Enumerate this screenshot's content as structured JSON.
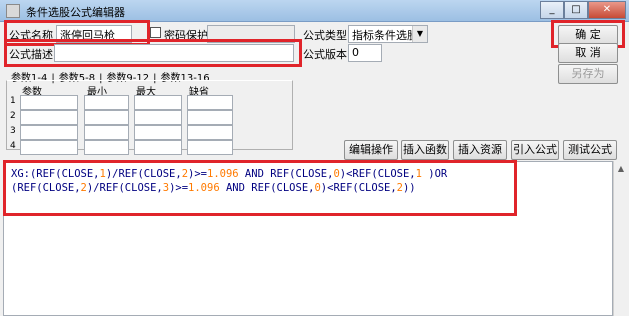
{
  "window": {
    "title": "条件选股公式编辑器",
    "min_label": "_",
    "max_label": "□",
    "close_label": "✕"
  },
  "form": {
    "name_label": "公式名称",
    "name_value": "涨停回马枪",
    "password_label": "密码保护",
    "password_value": "",
    "type_label": "公式类型",
    "type_value": "指标条件选股",
    "desc_label": "公式描述",
    "desc_value": "",
    "version_label": "公式版本",
    "version_value": "0"
  },
  "buttons": {
    "ok": "确  定",
    "cancel": "取  消",
    "save_as": "另存为",
    "edit_ops": "编辑操作",
    "insert_func": "插入函数",
    "insert_resource": "插入资源",
    "import_formula": "引入公式",
    "test_formula": "测试公式"
  },
  "params": {
    "tabs": [
      "参数1-4",
      "参数5-8",
      "参数9-12",
      "参数13-16"
    ],
    "tab_sep": "|",
    "headers": [
      "参数",
      "最小",
      "最大",
      "缺省"
    ],
    "rows": [
      "1",
      "2",
      "3",
      "4"
    ]
  },
  "code": {
    "line1_a": "XG:(REF(CLOSE,",
    "line1_b": "1",
    "line1_c": ")/REF(CLOSE,",
    "line1_d": "2",
    "line1_e": ")>=",
    "line1_f": "1.096",
    "line1_g": " AND REF(CLOSE,",
    "line1_h": "0",
    "line1_i": ")<REF(CLOSE,",
    "line1_j": "1",
    "line1_k": " )OR",
    "line2_a": "(REF(CLOSE,",
    "line2_b": "2",
    "line2_c": ")/REF(CLOSE,",
    "line2_d": "3",
    "line2_e": ")>=",
    "line2_f": "1.096",
    "line2_g": " AND REF(CLOSE,",
    "line2_h": "0",
    "line2_i": ")<REF(CLOSE,",
    "line2_j": "2",
    "line2_k": "))"
  },
  "colors": {
    "highlight": "#e0242a",
    "code_text": "#000080",
    "code_number": "#ff7a00"
  }
}
